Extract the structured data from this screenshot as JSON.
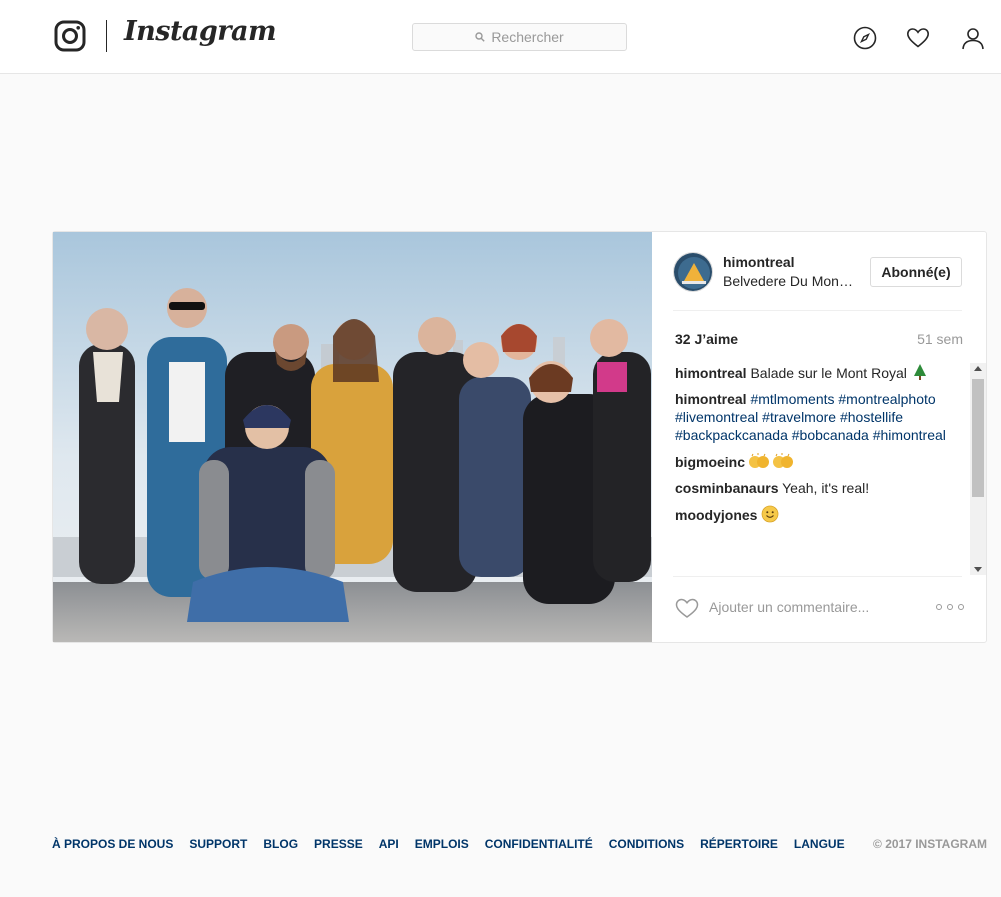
{
  "header": {
    "logo_text": "Instagram",
    "search_placeholder": "Rechercher"
  },
  "post": {
    "author": "himontreal",
    "location": "Belvedere Du Mont Royal",
    "follow_label": "Abonné(e)",
    "likes": "32 J’aime",
    "age": "51 sem",
    "caption": {
      "user": "himontreal",
      "text": "Balade sur le Mont Royal",
      "emoji_icon": "evergreen-tree-icon"
    },
    "comments": [
      {
        "user": "himontreal",
        "tags": [
          "#mtlmoments",
          "#montrealphoto",
          "#livemontreal",
          "#travelmore",
          "#hostellife",
          "#backpackcanada",
          "#bobcanada",
          "#himontreal"
        ]
      },
      {
        "user": "bigmoeinc",
        "emoji_icon": "clapping-hands-icon"
      },
      {
        "user": "cosminbanaurs",
        "text": "Yeah, it's real!"
      },
      {
        "user": "moodyjones",
        "emoji_icon": "smiling-face-icon"
      }
    ],
    "comment_placeholder": "Ajouter un commentaire..."
  },
  "footer": {
    "links": [
      "À PROPOS DE NOUS",
      "SUPPORT",
      "BLOG",
      "PRESSE",
      "API",
      "EMPLOIS",
      "CONFIDENTIALITÉ",
      "CONDITIONS",
      "RÉPERTOIRE",
      "LANGUE"
    ],
    "copyright": "© 2017 INSTAGRAM"
  },
  "colors": {
    "link": "#003569",
    "muted": "#999999",
    "text": "#262626",
    "background": "#fafafa"
  }
}
